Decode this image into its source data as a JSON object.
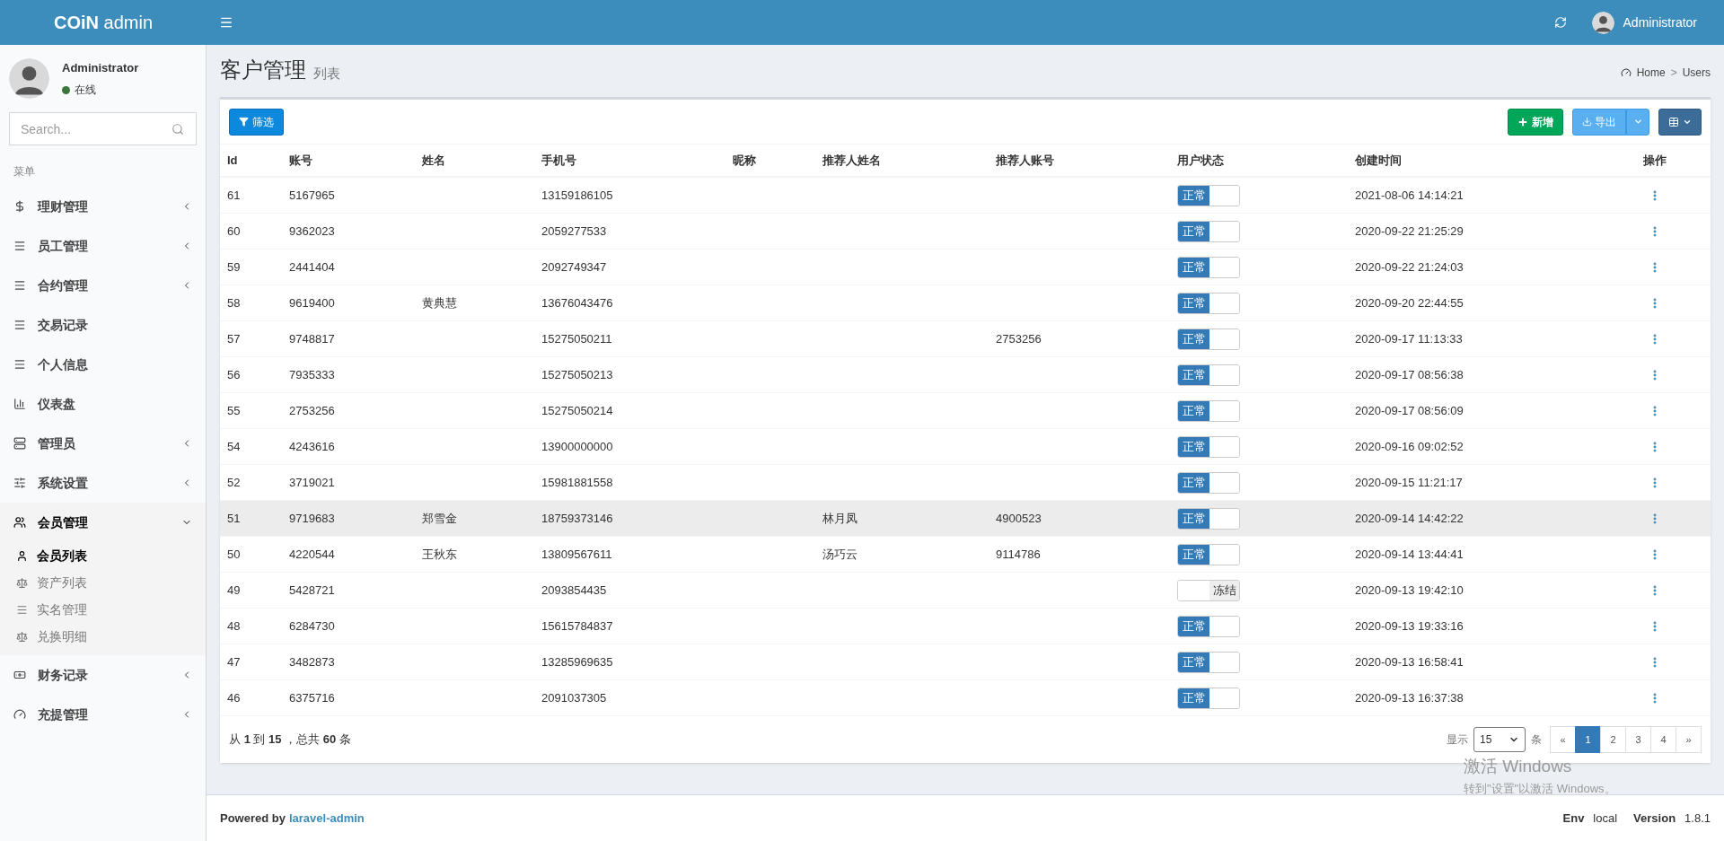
{
  "header": {
    "brand": "**COiN** admin",
    "user": "Administrator"
  },
  "sidebar": {
    "user": {
      "name": "Administrator",
      "status": "在线"
    },
    "search": {
      "placeholder": "Search..."
    },
    "menu_header": "菜单",
    "items": [
      {
        "label": "理财管理",
        "expandable": true,
        "expanded": false
      },
      {
        "label": "员工管理",
        "expandable": true,
        "expanded": false
      },
      {
        "label": "合约管理",
        "expandable": true,
        "expanded": false
      },
      {
        "label": "交易记录",
        "expandable": false,
        "expanded": false
      },
      {
        "label": "个人信息",
        "expandable": false,
        "expanded": false
      },
      {
        "label": "仪表盘",
        "expandable": false,
        "expanded": false
      },
      {
        "label": "管理员",
        "expandable": true,
        "expanded": false
      },
      {
        "label": "系统设置",
        "expandable": true,
        "expanded": false
      },
      {
        "label": "会员管理",
        "expandable": true,
        "expanded": true,
        "children": [
          {
            "label": "会员列表",
            "selected": true
          },
          {
            "label": "资产列表",
            "selected": false
          },
          {
            "label": "实名管理",
            "selected": false
          },
          {
            "label": "兑换明细",
            "selected": false
          }
        ]
      },
      {
        "label": "财务记录",
        "expandable": true,
        "expanded": false
      },
      {
        "label": "充提管理",
        "expandable": true,
        "expanded": false
      }
    ]
  },
  "page": {
    "title": "客户管理",
    "subtitle": "列表",
    "breadcrumb": [
      "Home",
      "Users"
    ],
    "breadcrumb_separator": ">"
  },
  "toolbar": {
    "filter_button": "筛选",
    "new_button": "新增",
    "export_button": "导出"
  },
  "table": {
    "columns": [
      "Id",
      "账号",
      "姓名",
      "手机号",
      "昵称",
      "推荐人姓名",
      "推荐人账号",
      "用户状态",
      "创建时间",
      "操作"
    ],
    "rows": [
      {
        "id": "61",
        "account": "5167965",
        "phone": "13159186105",
        "status": {
          "on": true,
          "label": "正常"
        },
        "created": "2021-08-06 14:14:21",
        "highlighted": false
      },
      {
        "id": "60",
        "account": "9362023",
        "phone": "2059277533",
        "status": {
          "on": true,
          "label": "正常"
        },
        "created": "2020-09-22 21:25:29",
        "highlighted": false
      },
      {
        "id": "59",
        "account": "2441404",
        "phone": "2092749347",
        "status": {
          "on": true,
          "label": "正常"
        },
        "created": "2020-09-22 21:24:03",
        "highlighted": false
      },
      {
        "id": "58",
        "account": "9619400",
        "name": "黄典慧",
        "phone": "13676043476",
        "status": {
          "on": true,
          "label": "正常"
        },
        "created": "2020-09-20 22:44:55",
        "highlighted": false
      },
      {
        "id": "57",
        "account": "9748817",
        "phone": "15275050211",
        "referrer_account": "2753256",
        "status": {
          "on": true,
          "label": "正常"
        },
        "created": "2020-09-17 11:13:33",
        "highlighted": false
      },
      {
        "id": "56",
        "account": "7935333",
        "phone": "15275050213",
        "status": {
          "on": true,
          "label": "正常"
        },
        "created": "2020-09-17 08:56:38",
        "highlighted": false
      },
      {
        "id": "55",
        "account": "2753256",
        "phone": "15275050214",
        "status": {
          "on": true,
          "label": "正常"
        },
        "created": "2020-09-17 08:56:09",
        "highlighted": false
      },
      {
        "id": "54",
        "account": "4243616",
        "phone": "13900000000",
        "status": {
          "on": true,
          "label": "正常"
        },
        "created": "2020-09-16 09:02:52",
        "highlighted": false
      },
      {
        "id": "52",
        "account": "3719021",
        "phone": "15981881558",
        "status": {
          "on": true,
          "label": "正常"
        },
        "created": "2020-09-15 11:21:17",
        "highlighted": false
      },
      {
        "id": "51",
        "account": "9719683",
        "name": "郑雪金",
        "phone": "18759373146",
        "referrer_name": "林月凤",
        "referrer_account": "4900523",
        "status": {
          "on": true,
          "label": "正常"
        },
        "created": "2020-09-14 14:42:22",
        "highlighted": true
      },
      {
        "id": "50",
        "account": "4220544",
        "name": "王秋东",
        "phone": "13809567611",
        "referrer_name": "汤巧云",
        "referrer_account": "9114786",
        "status": {
          "on": true,
          "label": "正常"
        },
        "created": "2020-09-14 13:44:41",
        "highlighted": false
      },
      {
        "id": "49",
        "account": "5428721",
        "phone": "2093854435",
        "status": {
          "on": false,
          "label": "冻结"
        },
        "created": "2020-09-13 19:42:10",
        "highlighted": false
      },
      {
        "id": "48",
        "account": "6284730",
        "phone": "15615784837",
        "status": {
          "on": true,
          "label": "正常"
        },
        "created": "2020-09-13 19:33:16",
        "highlighted": false
      },
      {
        "id": "47",
        "account": "3482873",
        "phone": "13285969635",
        "status": {
          "on": true,
          "label": "正常"
        },
        "created": "2020-09-13 16:58:41",
        "highlighted": false
      },
      {
        "id": "46",
        "account": "6375716",
        "phone": "2091037305",
        "status": {
          "on": true,
          "label": "正常"
        },
        "created": "2020-09-13 16:37:38",
        "highlighted": false
      }
    ]
  },
  "summary": "从 **1** 到 **15** ，总共 **60** 条",
  "pagination": {
    "per_page_label": "显示",
    "per_page": "15",
    "unit": "条",
    "pages": [
      {
        "label": "«",
        "selected": false
      },
      {
        "label": "1",
        "selected": true
      },
      {
        "label": "2",
        "selected": false
      },
      {
        "label": "3",
        "selected": false
      },
      {
        "label": "4",
        "selected": false
      },
      {
        "label": "»",
        "selected": false
      }
    ]
  },
  "os_notice": {
    "title": "激活 Windows",
    "subtitle": "转到\"设置\"以激活 Windows。"
  },
  "footer": {
    "powered_by": "Powered by",
    "link": "laravel-admin",
    "env_label": "Env",
    "env": "local",
    "version_label": "Version",
    "version": "1.8.1"
  }
}
